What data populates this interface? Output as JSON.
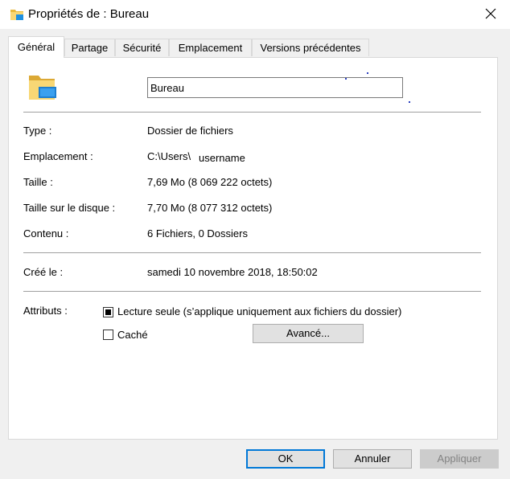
{
  "window": {
    "title": "Propriétés de : Bureau",
    "close_icon": "close-icon",
    "folder_icon": "folder-desktop-icon"
  },
  "tabs": [
    {
      "label": "Général",
      "active": true
    },
    {
      "label": "Partage",
      "active": false
    },
    {
      "label": "Sécurité",
      "active": false
    },
    {
      "label": "Emplacement",
      "active": false
    },
    {
      "label": "Versions précédentes",
      "active": false
    }
  ],
  "general": {
    "name_value": "Bureau",
    "type_label": "Type :",
    "type_value": "Dossier de fichiers",
    "location_label": "Emplacement :",
    "location_value": "C:\\Users\\",
    "location_user": "username",
    "size_label": "Taille :",
    "size_value": "7,69 Mo (8 069 222 octets)",
    "disk_size_label": "Taille sur le disque :",
    "disk_size_value": "7,70 Mo (8 077 312 octets)",
    "contents_label": "Contenu :",
    "contents_value": "6 Fichiers, 0 Dossiers",
    "created_label": "Créé le :",
    "created_value": "samedi 10 novembre 2018, 18:50:02",
    "attributes_label": "Attributs :",
    "readonly_label": "Lecture seule (s’applique uniquement aux fichiers du dossier)",
    "readonly_state": "indeterminate",
    "hidden_label": "Caché",
    "hidden_state": "unchecked",
    "advanced_button": "Avancé..."
  },
  "footer": {
    "ok": "OK",
    "cancel": "Annuler",
    "apply": "Appliquer",
    "accent_color": "#0078d7"
  }
}
